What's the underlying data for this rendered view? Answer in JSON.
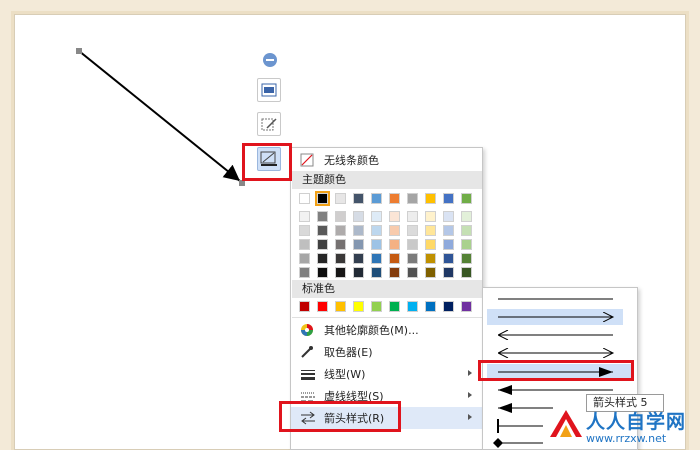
{
  "colors": {
    "accent_red": "#e0141d",
    "menu_highlight": "#dfe9f8",
    "selected_swatch_outline": "#f2a116"
  },
  "menu": {
    "no_line_color": "无线条颜色",
    "theme_colors_header": "主题颜色",
    "standard_colors_header": "标准色",
    "more_outline_colors": "其他轮廓颜色(M)...",
    "eyedropper": "取色器(E)",
    "line_type": "线型(W)",
    "dash_type": "虚线线型(S)",
    "arrow_style": "箭头样式(R)"
  },
  "theme_colors": {
    "top_row": [
      "#ffffff",
      "#000000",
      "#e7e6e6",
      "#44546a",
      "#5b9bd5",
      "#ed7d31",
      "#a5a5a5",
      "#ffc000",
      "#4472c4",
      "#70ad47"
    ],
    "shades": [
      [
        "#f2f2f2",
        "#808080",
        "#d0cece",
        "#d6dce5",
        "#deebf7",
        "#fbe5d6",
        "#ededed",
        "#fff2cc",
        "#dae3f3",
        "#e2f0d9"
      ],
      [
        "#d9d9d9",
        "#595959",
        "#aeabab",
        "#adb9ca",
        "#bdd7ee",
        "#f8cbad",
        "#dbdbdb",
        "#ffe699",
        "#b4c7e7",
        "#c5e0b4"
      ],
      [
        "#bfbfbf",
        "#404040",
        "#757171",
        "#8497b0",
        "#9dc3e6",
        "#f4b183",
        "#c9c9c9",
        "#ffd966",
        "#8faadc",
        "#a9d18e"
      ],
      [
        "#a6a6a6",
        "#262626",
        "#3a3838",
        "#333f50",
        "#2e75b6",
        "#c55a11",
        "#7b7b7b",
        "#bf9000",
        "#2f5597",
        "#548235"
      ],
      [
        "#7f7f7f",
        "#0d0d0d",
        "#171616",
        "#222a35",
        "#1f4e79",
        "#843c0c",
        "#525252",
        "#7f6000",
        "#203864",
        "#385723"
      ]
    ]
  },
  "standard_colors": [
    "#c00000",
    "#ff0000",
    "#ffc000",
    "#ffff00",
    "#92d050",
    "#00b050",
    "#00b0f0",
    "#0070c0",
    "#002060",
    "#7030a0"
  ],
  "tooltip": {
    "text": "箭头样式 5"
  },
  "watermark": {
    "title": "人人自学网",
    "url": "www.rrzxw.net"
  },
  "icons": {
    "collapse": "minus-circle-icon",
    "layout": "image-layout-icon",
    "edit": "edit-shape-icon",
    "outline": "line-outline-icon"
  }
}
